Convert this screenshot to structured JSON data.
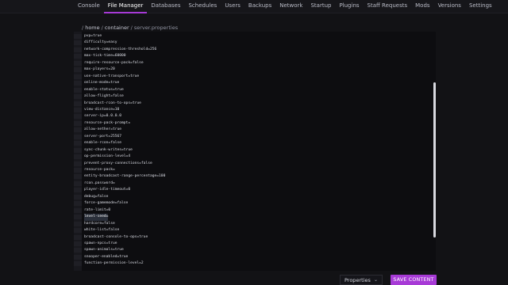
{
  "nav": {
    "tabs": [
      {
        "label": "Console",
        "active": false
      },
      {
        "label": "File Manager",
        "active": true
      },
      {
        "label": "Databases",
        "active": false
      },
      {
        "label": "Schedules",
        "active": false
      },
      {
        "label": "Users",
        "active": false
      },
      {
        "label": "Backups",
        "active": false
      },
      {
        "label": "Network",
        "active": false
      },
      {
        "label": "Startup",
        "active": false
      },
      {
        "label": "Plugins",
        "active": false
      },
      {
        "label": "Staff Requests",
        "active": false
      },
      {
        "label": "Mods",
        "active": false
      },
      {
        "label": "Versions",
        "active": false
      },
      {
        "label": "Settings",
        "active": false
      }
    ]
  },
  "breadcrumb": {
    "sep": "/",
    "home": "home",
    "container": "container",
    "file": "server.properties"
  },
  "editor": {
    "highlight_index": 27,
    "lines": [
      "pvp=true",
      "difficulty=easy",
      "network-compression-threshold=256",
      "max-tick-time=60000",
      "require-resource-pack=false",
      "max-players=20",
      "use-native-transport=true",
      "online-mode=true",
      "enable-status=true",
      "allow-flight=false",
      "broadcast-rcon-to-ops=true",
      "view-distance=10",
      "server-ip=0.0.0.0",
      "resource-pack-prompt=",
      "allow-nether=true",
      "server-port=25567",
      "enable-rcon=false",
      "sync-chunk-writes=true",
      "op-permission-level=4",
      "prevent-proxy-connections=false",
      "resource-pack=",
      "entity-broadcast-range-percentage=100",
      "rcon.password=",
      "player-idle-timeout=0",
      "debug=false",
      "force-gamemode=false",
      "rate-limit=0",
      "level-seed=",
      "hardcore=false",
      "white-list=false",
      "broadcast-console-to-ops=true",
      "spawn-npcs=true",
      "spawn-animals=true",
      "snooper-enabled=true",
      "function-permission-level=2"
    ]
  },
  "footer": {
    "mode_select": "Properties",
    "save_label": "SAVE CONTENT"
  },
  "colors": {
    "accent": "#a73ad6",
    "background": "#121215",
    "editor_bg": "#0d0d10"
  }
}
